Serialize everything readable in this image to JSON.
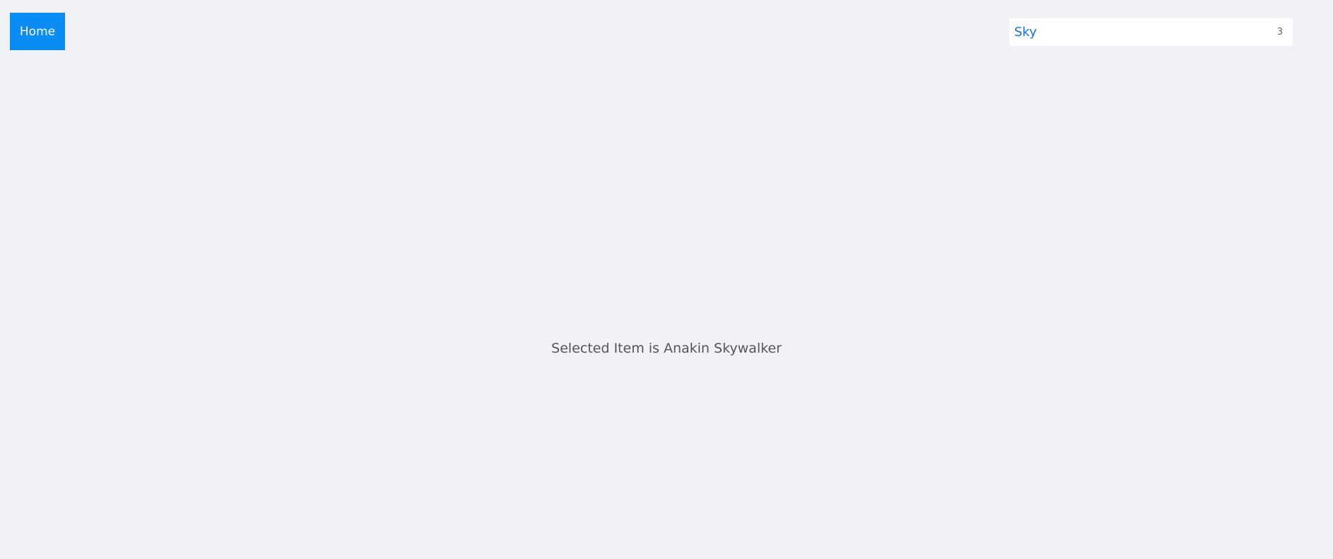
{
  "header": {
    "home_label": "Home"
  },
  "search": {
    "value": "Sky",
    "result_count": "3"
  },
  "main": {
    "selected_text": "Selected Item is Anakin Skywalker"
  },
  "colors": {
    "background": "#f0f2f5",
    "accent": "#0a8cf5",
    "input_text": "#1a73e8"
  }
}
